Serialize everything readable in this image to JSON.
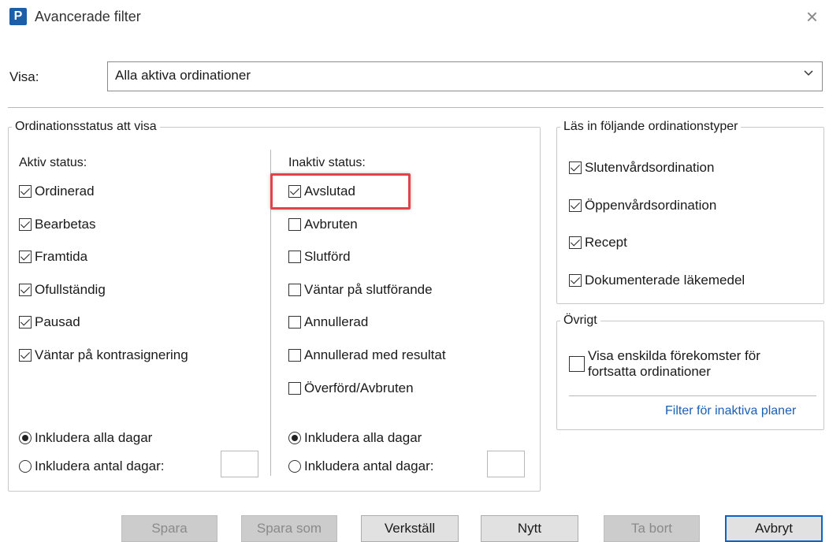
{
  "window": {
    "app_icon_letter": "P",
    "title": "Avancerade filter",
    "close_glyph": "×"
  },
  "visa": {
    "label": "Visa:",
    "selected": "Alla aktiva ordinationer"
  },
  "status_group": {
    "legend": "Ordinationsstatus att visa",
    "active": {
      "heading": "Aktiv status:",
      "items": [
        {
          "label": "Ordinerad",
          "checked": true
        },
        {
          "label": "Bearbetas",
          "checked": true
        },
        {
          "label": "Framtida",
          "checked": true
        },
        {
          "label": "Ofullständig",
          "checked": true
        },
        {
          "label": "Pausad",
          "checked": true
        },
        {
          "label": "Väntar på kontrasignering",
          "checked": true
        }
      ],
      "radio_all": "Inkludera alla dagar",
      "radio_count": "Inkludera antal dagar:",
      "selected_radio": "all"
    },
    "inactive": {
      "heading": "Inaktiv status:",
      "items": [
        {
          "label": "Avslutad",
          "checked": true
        },
        {
          "label": "Avbruten",
          "checked": false
        },
        {
          "label": "Slutförd",
          "checked": false
        },
        {
          "label": "Väntar på slutförande",
          "checked": false
        },
        {
          "label": "Annullerad",
          "checked": false
        },
        {
          "label": "Annullerad med resultat",
          "checked": false
        },
        {
          "label": "Överförd/Avbruten",
          "checked": false
        }
      ],
      "radio_all": "Inkludera alla dagar",
      "radio_count": "Inkludera antal dagar:",
      "selected_radio": "all"
    }
  },
  "types_group": {
    "legend": "Läs in följande ordinationstyper",
    "items": [
      {
        "label": "Slutenvårdsordination",
        "checked": true
      },
      {
        "label": "Öppenvårdsordination",
        "checked": true
      },
      {
        "label": "Recept",
        "checked": true
      },
      {
        "label": "Dokumenterade läkemedel",
        "checked": true
      }
    ]
  },
  "other_group": {
    "legend": "Övrigt",
    "item_line1": "Visa enskilda förekomster för",
    "item_line2": "fortsatta ordinationer",
    "item_checked": false,
    "link": "Filter för inaktiva planer"
  },
  "buttons": {
    "spara": "Spara",
    "spara_som": "Spara som",
    "verkstall": "Verkställ",
    "nytt": "Nytt",
    "ta_bort": "Ta bort",
    "avbryt": "Avbryt"
  },
  "colors": {
    "highlight": "#e0434a",
    "link": "#1a5fb4",
    "app_icon": "#1d5ea8"
  }
}
